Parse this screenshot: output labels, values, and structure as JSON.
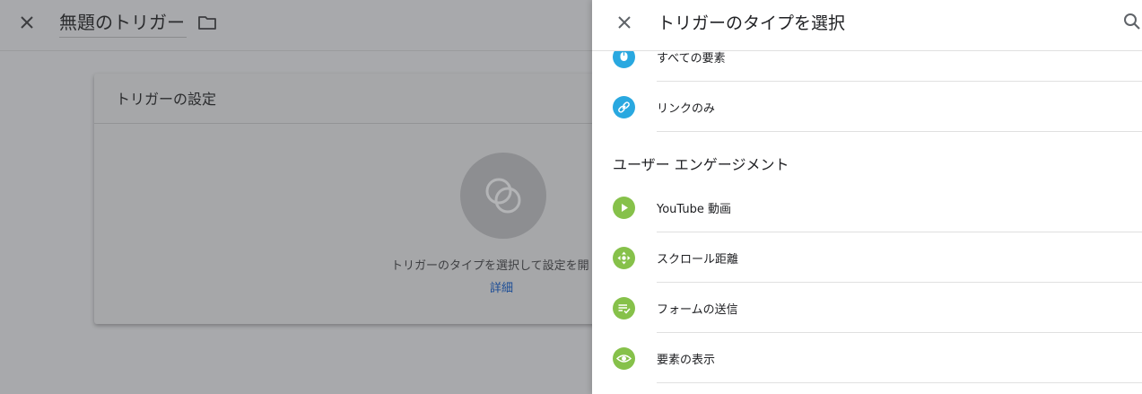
{
  "left": {
    "title": "無題のトリガー",
    "card_title": "トリガーの設定",
    "hint": "トリガーのタイプを選択して設定を開",
    "more_link": "詳細"
  },
  "sheet": {
    "title": "トリガーのタイプを選択",
    "click_items": [
      {
        "label": "すべての要素",
        "icon": "cursor-icon",
        "color": "#29a8e0"
      },
      {
        "label": "リンクのみ",
        "icon": "link-icon",
        "color": "#29a8e0"
      }
    ],
    "engagement_section": "ユーザー エンゲージメント",
    "engagement_items": [
      {
        "label": "YouTube 動画",
        "icon": "play-icon",
        "color": "#86c14a"
      },
      {
        "label": "スクロール距離",
        "icon": "move-arrows-icon",
        "color": "#86c14a"
      },
      {
        "label": "フォームの送信",
        "icon": "form-check-icon",
        "color": "#86c14a"
      },
      {
        "label": "要素の表示",
        "icon": "eye-icon",
        "color": "#86c14a"
      }
    ]
  }
}
